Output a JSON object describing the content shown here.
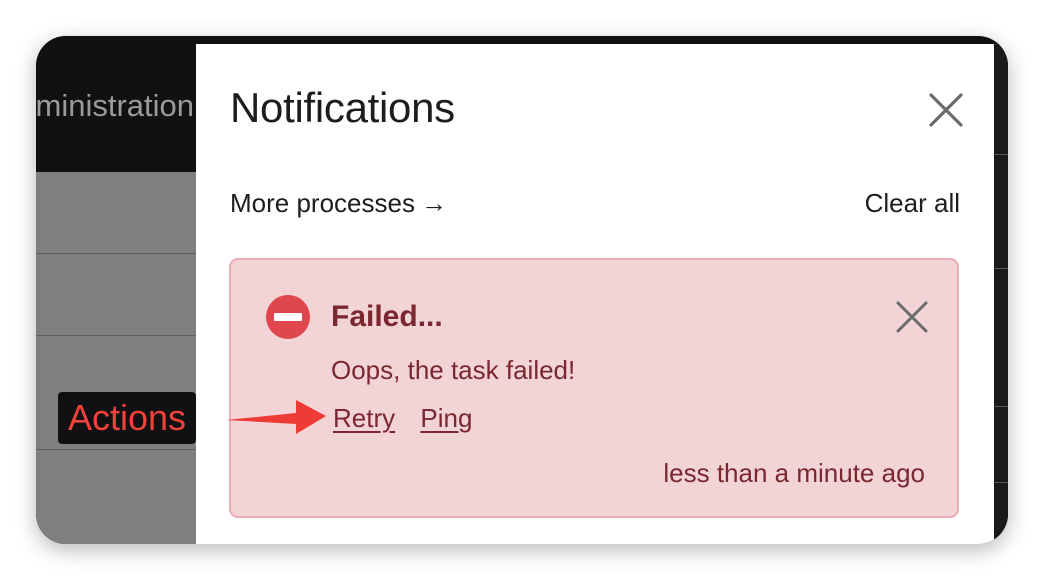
{
  "background_app": {
    "header_text": "ministration"
  },
  "notifications": {
    "title": "Notifications",
    "more_processes": "More processes",
    "more_processes_arrow": "→",
    "clear_all": "Clear all",
    "close_icon": "close-icon"
  },
  "card": {
    "status": "error",
    "icon": "error-minus-circle-icon",
    "title": "Failed...",
    "message": "Oops, the task failed!",
    "actions": [
      "Retry",
      "Ping"
    ],
    "time": "less than a minute ago",
    "close_icon": "close-icon"
  },
  "annotation": {
    "label": "Actions"
  },
  "colors": {
    "card_background": "#f2d3d6",
    "card_border": "#e8aeb3",
    "card_text": "#7a2730",
    "error_icon": "#e0474c",
    "annotation_red": "#f0413a",
    "dark_header": "#111113",
    "gray_body": "#7f7f7f"
  }
}
